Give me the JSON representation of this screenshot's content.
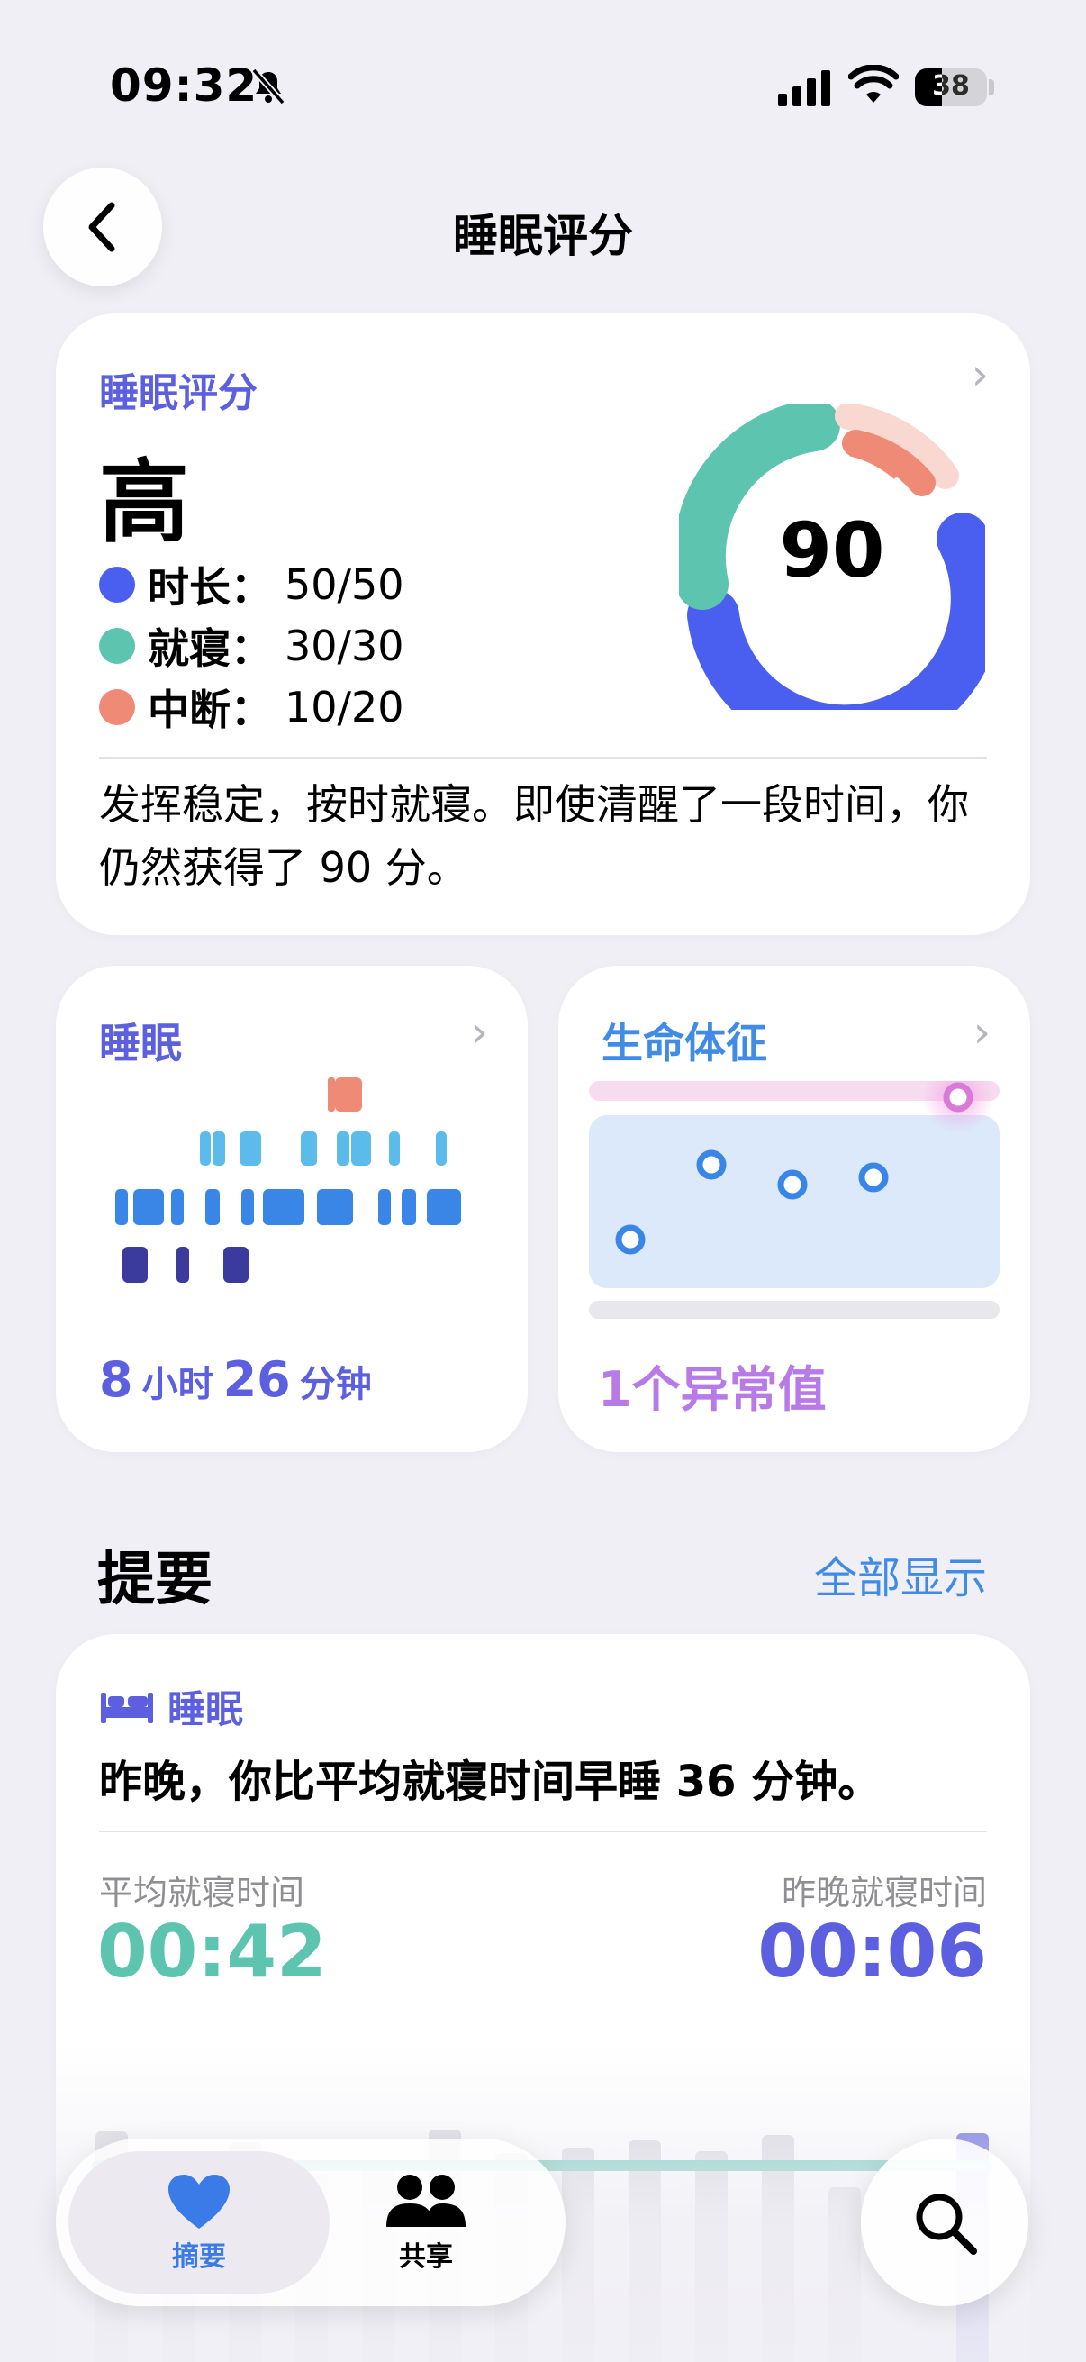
{
  "status_bar": {
    "time": "09:32",
    "battery": "38"
  },
  "nav": {
    "title": "睡眠评分"
  },
  "score_card": {
    "title": "睡眠评分",
    "level": "高",
    "score": "90",
    "legend": [
      {
        "label": "时长：",
        "value": "50/50",
        "color": "#4a5ff0"
      },
      {
        "label": "就寝：",
        "value": "30/30",
        "color": "#5dc4b0"
      },
      {
        "label": "中断：",
        "value": "10/20",
        "color": "#ee8a76"
      }
    ],
    "description": "发挥稳定，按时就寝。即使清醒了一段时间，你仍然获得了 90 分。"
  },
  "sleep_card": {
    "title": "睡眠",
    "hours": "8",
    "hours_unit": "小时",
    "minutes": "26",
    "minutes_unit": "分钟"
  },
  "vitals_card": {
    "title": "生命体征",
    "note": "1个异常值"
  },
  "summary": {
    "title": "提要",
    "show_all": "全部显示",
    "category": "睡眠",
    "text": "昨晚，你比平均就寝时间早睡 36 分钟。",
    "avg_label": "平均就寝时间",
    "avg_value": "00:42",
    "last_label": "昨晚就寝时间",
    "last_value": "00:06"
  },
  "tabbar": {
    "summary_label": "摘要",
    "sharing_label": "共享"
  },
  "colors": {
    "accent": "#5b5fe0",
    "teal": "#5dc4b0",
    "blue": "#4a5ff0",
    "salmon": "#ee8a76",
    "link": "#3f8be6"
  }
}
